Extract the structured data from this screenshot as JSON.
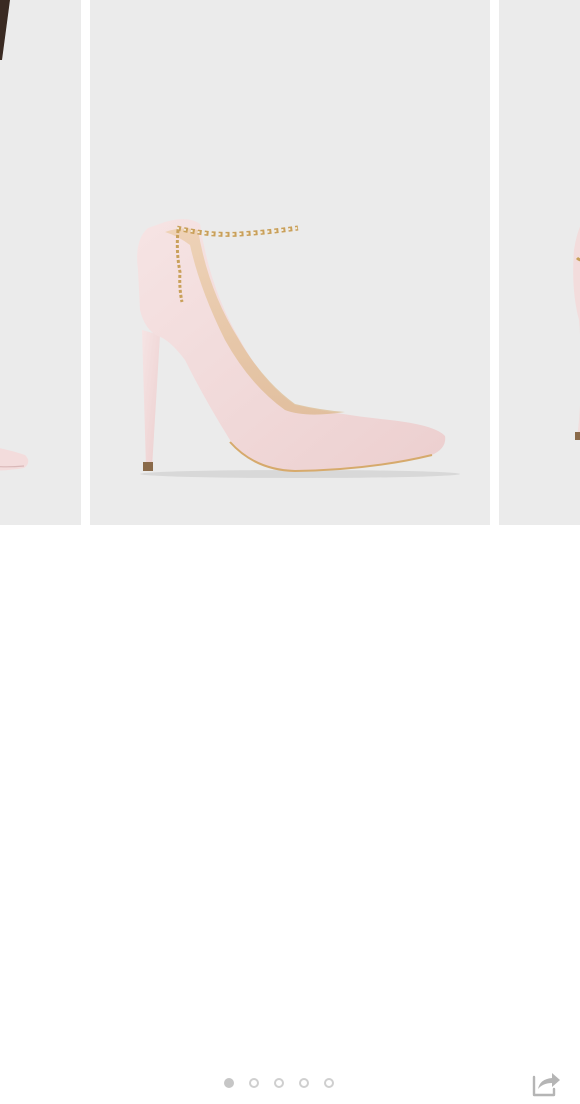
{
  "carousel": {
    "slides": [
      {
        "name": "heel-side-view-partial"
      },
      {
        "name": "blush-pointed-pump-with-ankle-chain"
      },
      {
        "name": "heel-back-view-partial"
      }
    ],
    "active_index": 0,
    "dot_count": 5
  },
  "colors": {
    "slide_background": "#ebebeb",
    "shoe_suede": "#f3dcdc",
    "gold_chain": "#c9a05a",
    "dot_active": "#c6c6c6",
    "dot_inactive": "#cfcfcf",
    "share_icon": "#b5b5b5"
  },
  "icons": {
    "share": "share-icon"
  }
}
